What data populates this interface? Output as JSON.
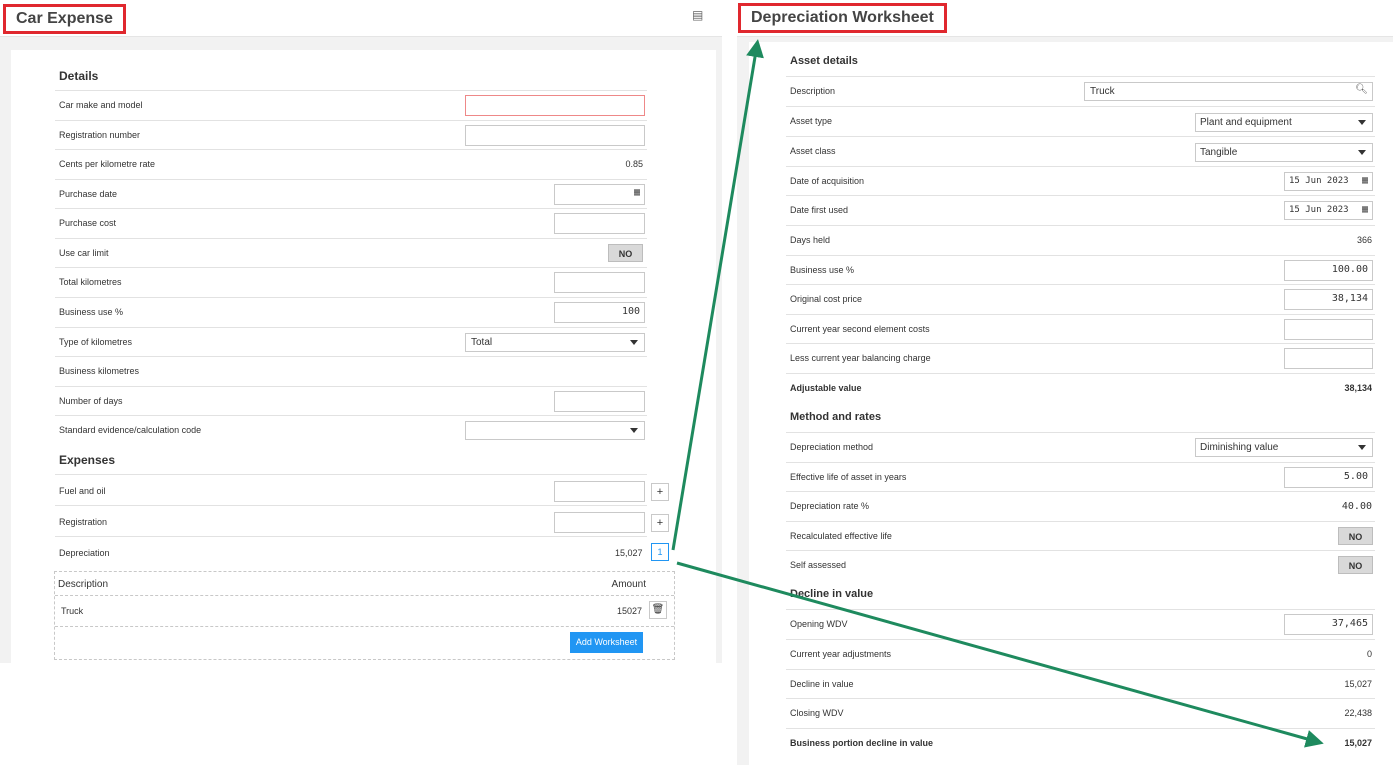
{
  "left": {
    "title": "Car Expense",
    "details_heading": "Details",
    "details": [
      {
        "label": "Car make and model",
        "value": ""
      },
      {
        "label": "Registration number",
        "value": ""
      },
      {
        "label": "Cents per kilometre rate",
        "value": "0.85"
      },
      {
        "label": "Purchase date",
        "value": ""
      },
      {
        "label": "Purchase cost",
        "value": ""
      },
      {
        "label": "Use car limit",
        "value": "NO"
      },
      {
        "label": "Total kilometres",
        "value": ""
      },
      {
        "label": "Business use %",
        "value": "100"
      },
      {
        "label": "Type of kilometres",
        "value": "Total"
      },
      {
        "label": "Business kilometres",
        "value": ""
      },
      {
        "label": "Number of days",
        "value": ""
      },
      {
        "label": "Standard evidence/calculation code",
        "value": ""
      }
    ],
    "expenses_heading": "Expenses",
    "expenses": [
      {
        "label": "Fuel and oil",
        "value": "",
        "button": "+"
      },
      {
        "label": "Registration",
        "value": "",
        "button": "+"
      },
      {
        "label": "Depreciation",
        "value": "15,027",
        "button": "1"
      }
    ],
    "table": {
      "col_description": "Description",
      "col_amount": "Amount",
      "rows": [
        {
          "description": "Truck",
          "amount": "15027"
        }
      ],
      "add_button": "Add Worksheet"
    }
  },
  "right": {
    "title": "Depreciation Worksheet",
    "asset_heading": "Asset details",
    "asset": [
      {
        "label": "Description",
        "value": "Truck"
      },
      {
        "label": "Asset type",
        "value": "Plant and equipment"
      },
      {
        "label": "Asset class",
        "value": "Tangible"
      },
      {
        "label": "Date of acquisition",
        "value": "15 Jun 2023"
      },
      {
        "label": "Date first used",
        "value": "15 Jun 2023"
      },
      {
        "label": "Days held",
        "value": "366"
      },
      {
        "label": "Business use %",
        "value": "100.00"
      },
      {
        "label": "Original cost price",
        "value": "38,134"
      },
      {
        "label": "Current year second element costs",
        "value": ""
      },
      {
        "label": "Less current year balancing charge",
        "value": ""
      },
      {
        "label": "Adjustable value",
        "value": "38,134"
      }
    ],
    "method_heading": "Method and rates",
    "method": [
      {
        "label": "Depreciation method",
        "value": "Diminishing value"
      },
      {
        "label": "Effective life of asset in years",
        "value": "5.00"
      },
      {
        "label": "Depreciation rate %",
        "value": "40.00"
      },
      {
        "label": "Recalculated effective life",
        "value": "NO"
      },
      {
        "label": "Self assessed",
        "value": "NO"
      }
    ],
    "decline_heading": "Decline in value",
    "decline": [
      {
        "label": "Opening WDV",
        "value": "37,465"
      },
      {
        "label": "Current year adjustments",
        "value": "0"
      },
      {
        "label": "Decline in value",
        "value": "15,027"
      },
      {
        "label": "Closing WDV",
        "value": "22,438"
      },
      {
        "label": "Business portion decline in value",
        "value": "15,027"
      }
    ]
  },
  "annotation_colors": {
    "highlight_box": "#e0282e",
    "arrow": "#1e8a5e"
  }
}
